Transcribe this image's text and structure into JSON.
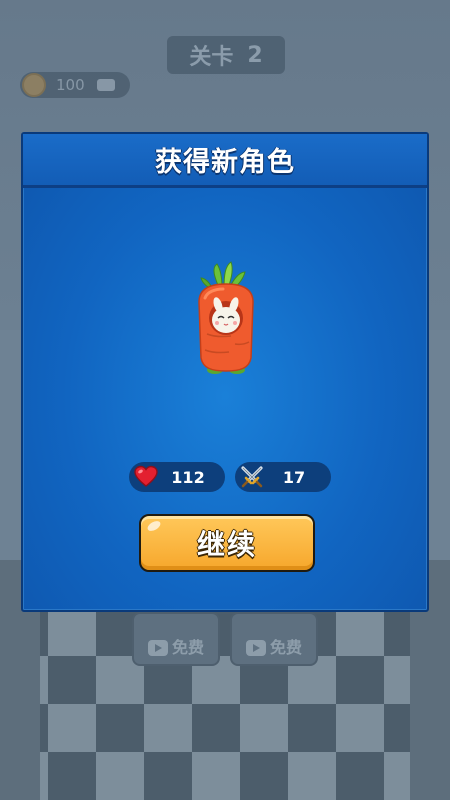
{
  "background": {
    "level_prefix": "关卡",
    "level_number": "2",
    "coins": "100",
    "left_button_label": "免费",
    "right_button_label": "免费"
  },
  "modal": {
    "title": "获得新角色",
    "character_icon": "carrot-bunny-character",
    "stats": {
      "hp_icon": "heart-icon",
      "hp": "112",
      "attack_icon": "crossed-swords-icon",
      "attack": "17"
    },
    "continue_label": "继续"
  },
  "colors": {
    "modal_blue": "#1165c1",
    "button_orange": "#f6a72c",
    "stat_pill": "#0d3f7c",
    "heart_red": "#e32030",
    "carrot_orange": "#ef5b2e"
  }
}
